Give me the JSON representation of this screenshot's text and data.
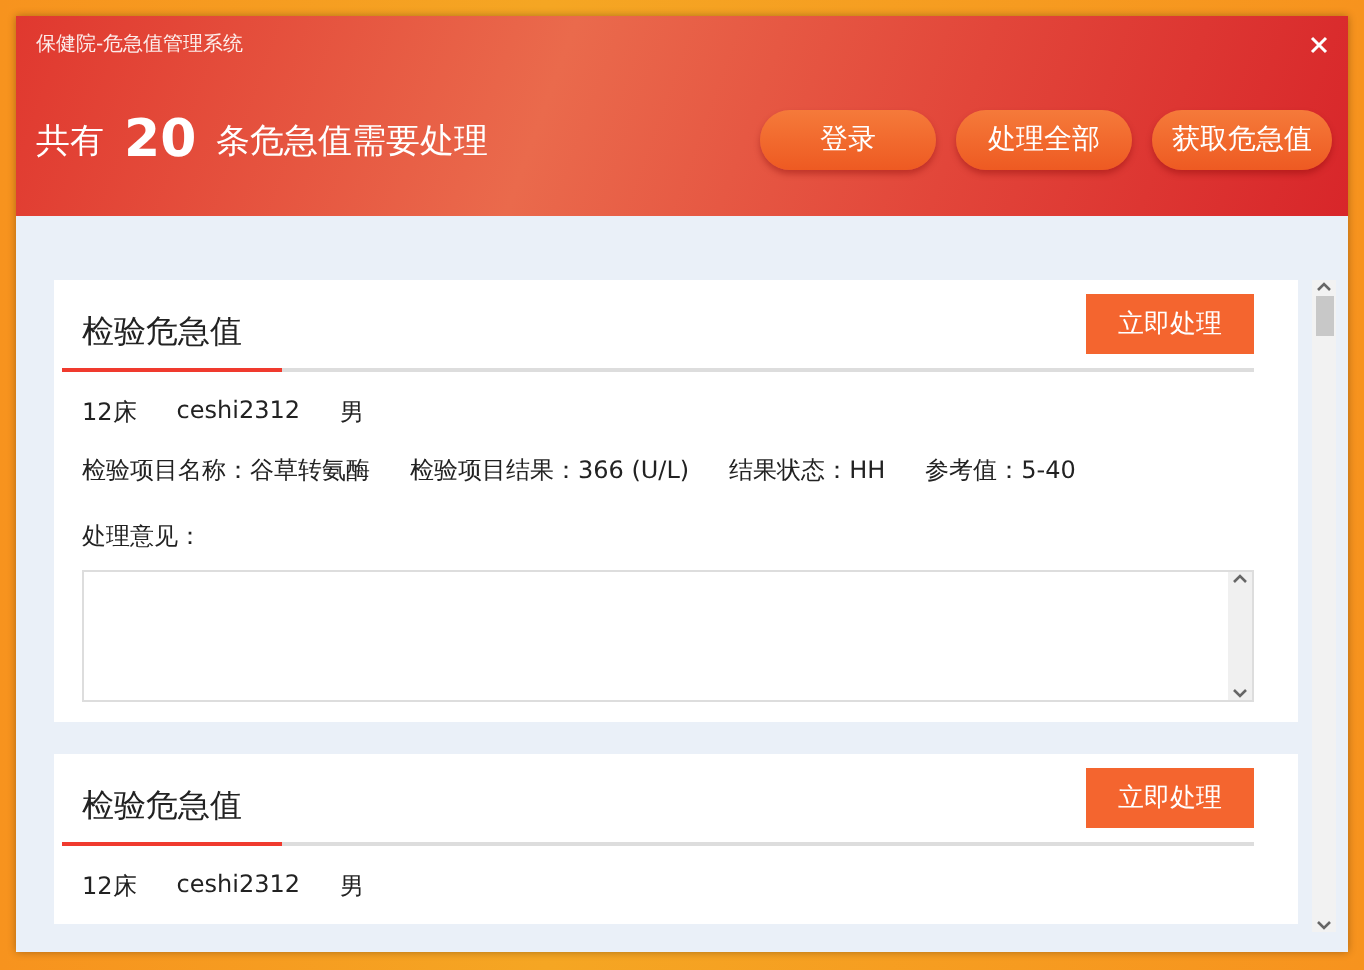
{
  "window": {
    "title": "保健院-危急值管理系统"
  },
  "header": {
    "prefix": "共有",
    "count": "20",
    "suffix": "条危急值需要处理",
    "buttons": [
      "登录",
      "处理全部",
      "获取危急值"
    ]
  },
  "cards": [
    {
      "title": "检验危急值",
      "action": "立即处理",
      "patient": [
        "12床",
        "ceshi2312",
        "男"
      ],
      "fields": [
        "检验项目名称：谷草转氨酶",
        "检验项目结果：366 (U/L)",
        "结果状态：HH",
        "参考值：5-40"
      ],
      "opinion": {
        "label": "处理意见："
      }
    },
    {
      "title": "检验危急值",
      "action": "立即处理",
      "patient": [
        "12床",
        "ceshi2312",
        "男"
      ]
    }
  ]
}
